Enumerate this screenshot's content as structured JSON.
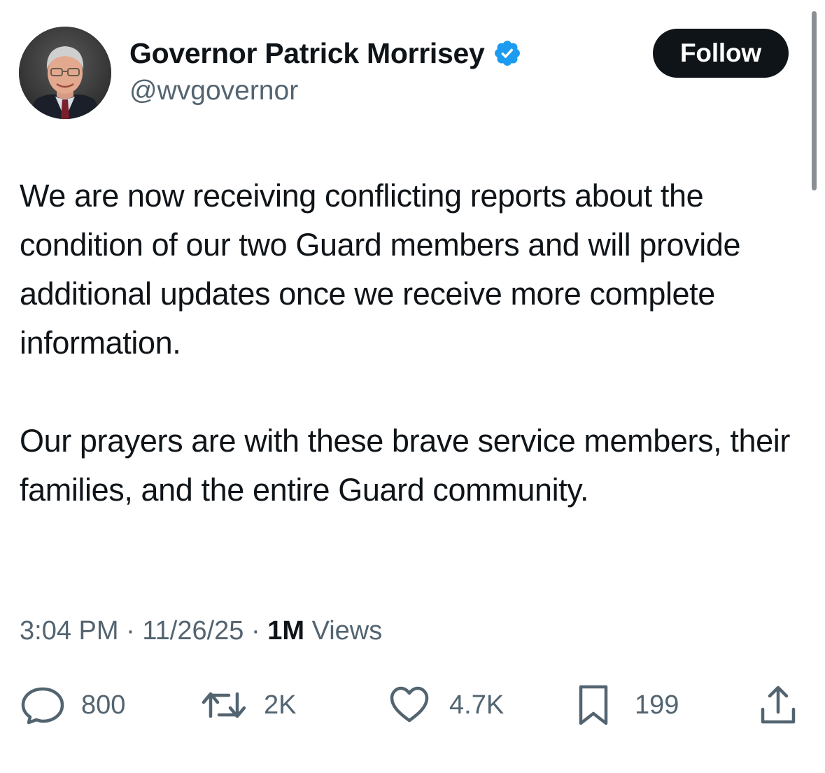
{
  "user": {
    "display_name": "Governor Patrick Morrisey",
    "handle": "@wvgovernor",
    "verified_icon": "verified-badge-icon",
    "verified_color": "#1d9bf0"
  },
  "follow_label": "Follow",
  "tweet": {
    "paragraphs": [
      "We are now receiving conflicting reports about the condition of our two Guard members and will provide additional updates once we receive more complete information.",
      "Our prayers are with these brave service members, their families, and the entire Guard community."
    ]
  },
  "meta": {
    "time": "3:04 PM",
    "separator": "·",
    "date": "11/26/25",
    "views_count": "1M",
    "views_label": "Views"
  },
  "actions": {
    "replies": "800",
    "reposts": "2K",
    "likes": "4.7K",
    "bookmarks": "199"
  },
  "colors": {
    "text": "#0f1419",
    "secondary": "#536471",
    "button_bg": "#0f1419"
  }
}
